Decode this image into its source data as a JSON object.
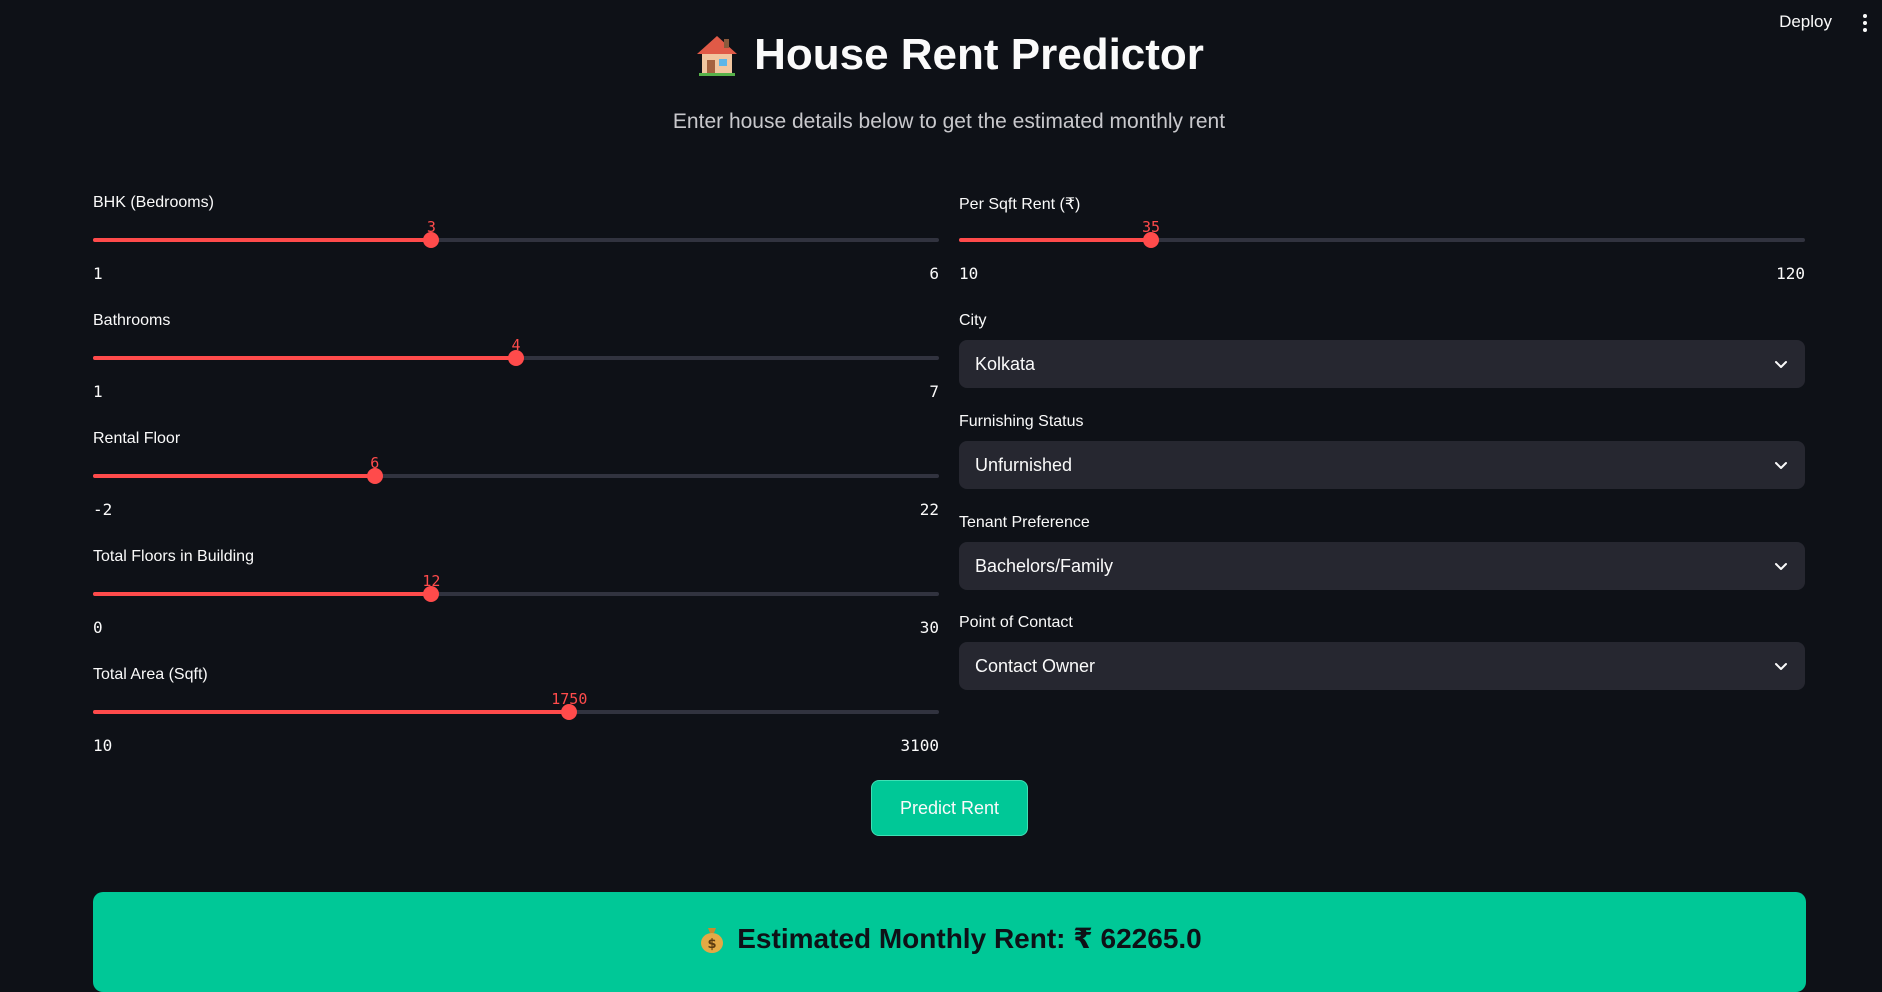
{
  "header": {
    "deploy_label": "Deploy"
  },
  "title": "House Rent Predictor",
  "subtitle": "Enter house details below to get the estimated monthly rent",
  "sliders": [
    {
      "label": "BHK (Bedrooms)",
      "value": "3",
      "min": "1",
      "max": "6",
      "fraction": 0.4
    },
    {
      "label": "Bathrooms",
      "value": "4",
      "min": "1",
      "max": "7",
      "fraction": 0.5
    },
    {
      "label": "Rental Floor",
      "value": "6",
      "min": "-2",
      "max": "22",
      "fraction": 0.333
    },
    {
      "label": "Total Floors in Building",
      "value": "12",
      "min": "0",
      "max": "30",
      "fraction": 0.4
    },
    {
      "label": "Total Area (Sqft)",
      "value": "1750",
      "min": "10",
      "max": "3100",
      "fraction": 0.563
    },
    {
      "label": "Per Sqft Rent (₹)",
      "value": "35",
      "min": "10",
      "max": "120",
      "fraction": 0.227
    }
  ],
  "selects": [
    {
      "label": "City",
      "value": "Kolkata"
    },
    {
      "label": "Furnishing Status",
      "value": "Unfurnished"
    },
    {
      "label": "Tenant Preference",
      "value": "Bachelors/Family"
    },
    {
      "label": "Point of Contact",
      "value": "Contact Owner"
    }
  ],
  "predict_button": "Predict Rent",
  "result": {
    "text": "Estimated Monthly Rent: ₹ 62265.0"
  },
  "colors": {
    "background": "#0e1117",
    "accent": "#ff4b4b",
    "success": "#00c897",
    "input_bg": "#262730"
  },
  "icons": {
    "title": "house-icon",
    "result": "money-bag-icon",
    "select": "chevron-down-icon",
    "menu": "more-vertical-icon"
  }
}
